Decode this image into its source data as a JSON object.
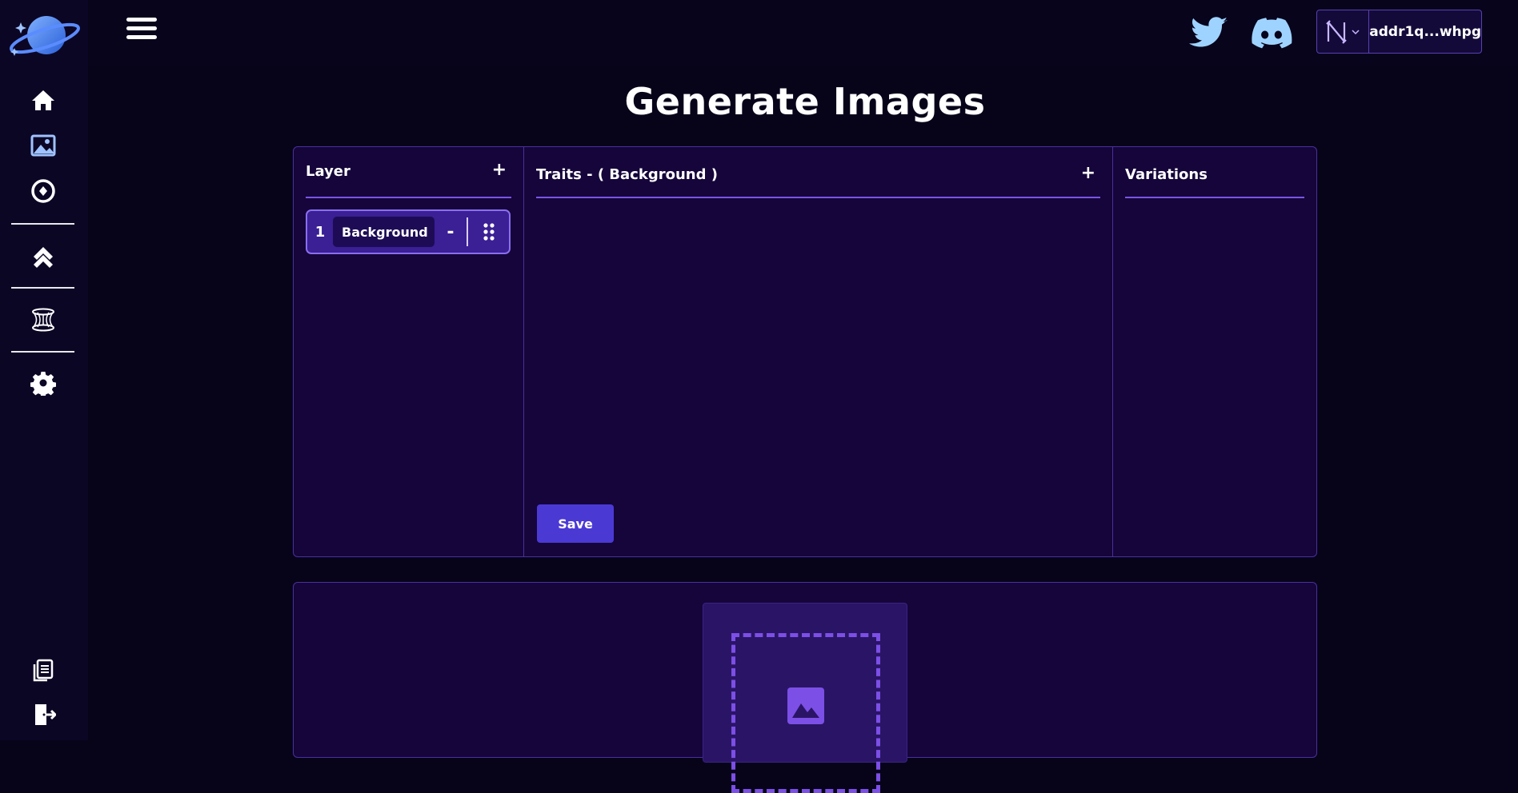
{
  "sidebar": {
    "logo": "planet-logo",
    "nav": [
      {
        "icon": "home-icon"
      },
      {
        "icon": "image-icon"
      },
      {
        "icon": "compass-icon"
      },
      {
        "icon": "double-chevron-up-icon"
      },
      {
        "icon": "portal-icon"
      },
      {
        "icon": "gear-icon"
      }
    ],
    "bottom": [
      {
        "icon": "documents-icon"
      },
      {
        "icon": "logout-icon"
      }
    ]
  },
  "topbar": {
    "wallet_address": "addr1q...whpg",
    "social": [
      "twitter-icon",
      "discord-icon"
    ]
  },
  "page": {
    "title": "Generate Images"
  },
  "editor": {
    "layer_heading": "Layer",
    "traits_heading": "Traits - ( Background )",
    "variations_heading": "Variations",
    "add_label": "+",
    "layers": [
      {
        "index": "1",
        "name": "Background",
        "remove_label": "-"
      }
    ],
    "save_label": "Save"
  },
  "colors": {
    "background": "#07041a",
    "panel": "#15053a",
    "accent": "#7a55e8",
    "button": "#4b39d4",
    "icon_blue": "#9fc3ff"
  }
}
